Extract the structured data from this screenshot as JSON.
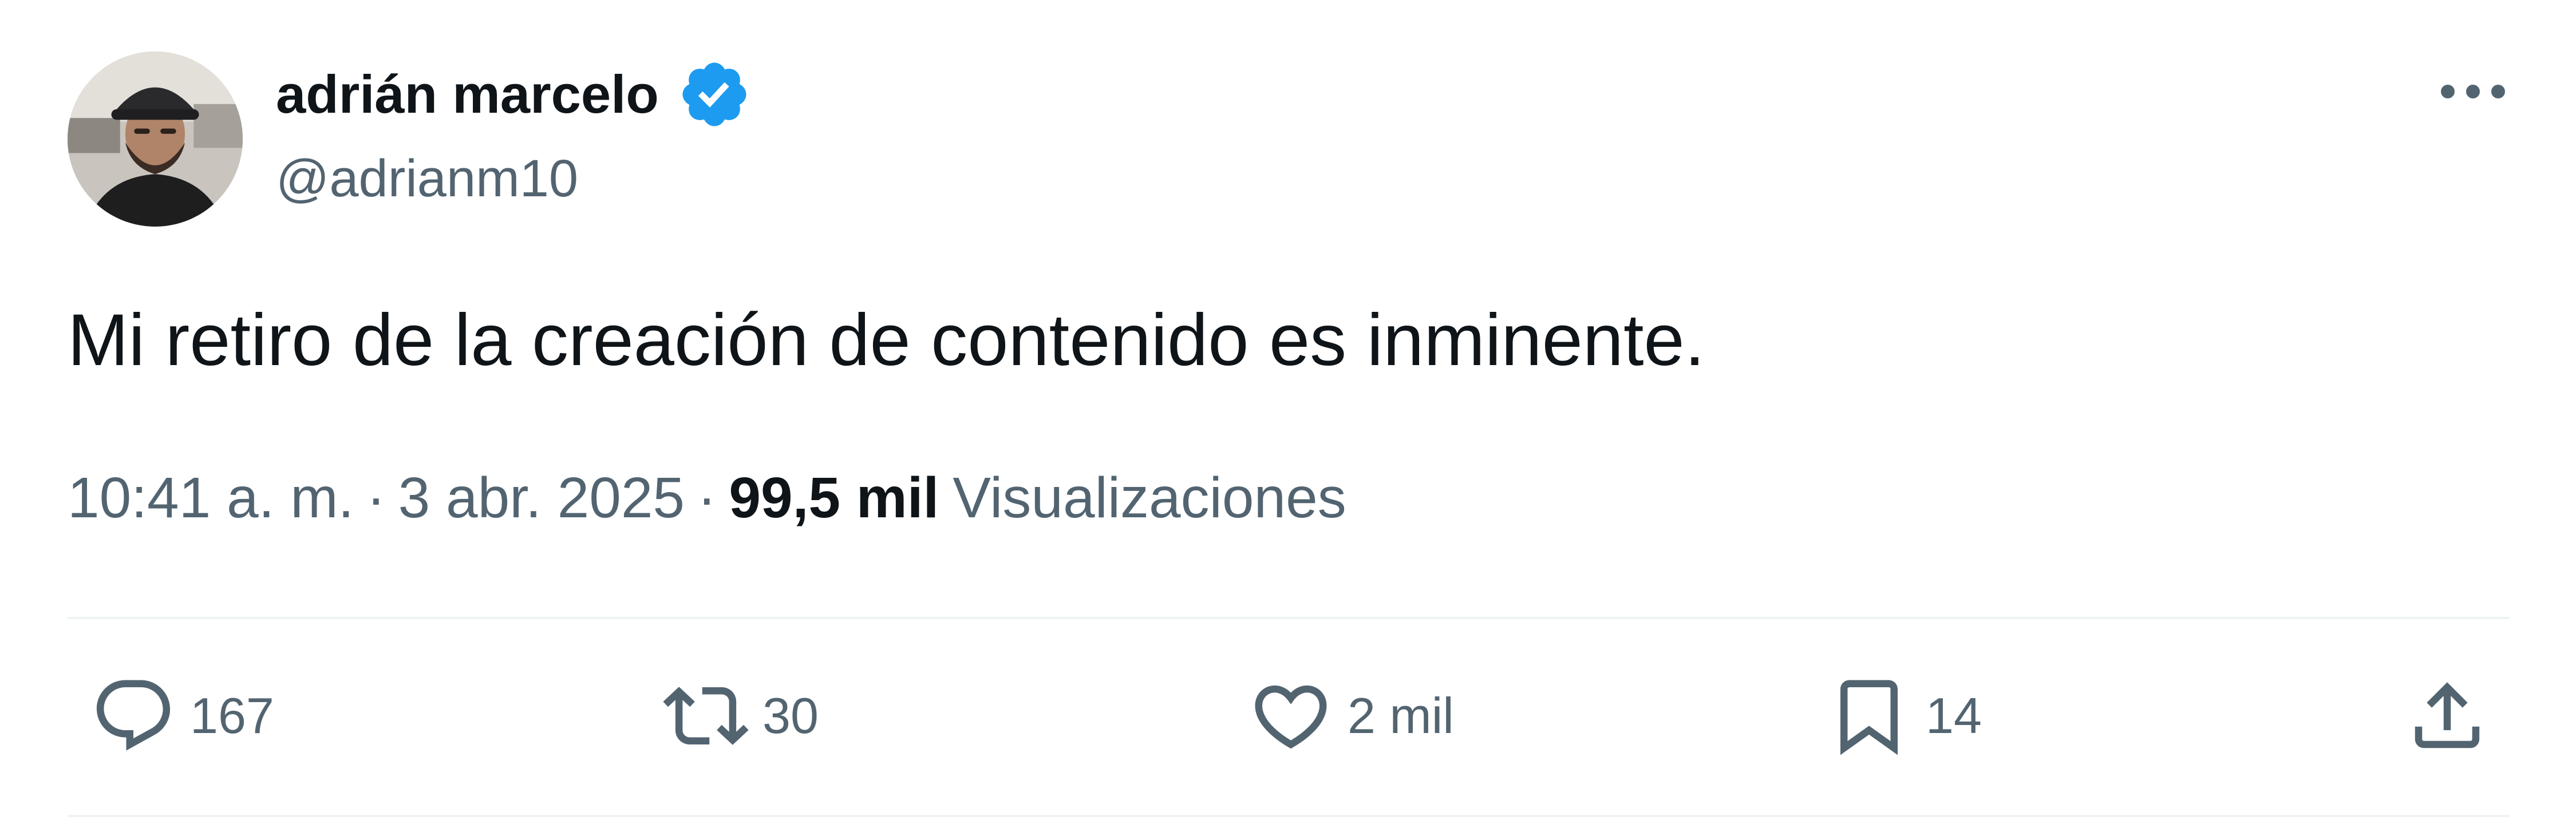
{
  "author": {
    "display_name": "adrián marcelo",
    "handle": "@adrianm10",
    "verified": true
  },
  "tweet": {
    "text": "Mi retiro de la creación de contenido es inminente.",
    "time": "10:41 a. m.",
    "date": "3 abr. 2025",
    "views_count": "99,5 mil",
    "views_label": "Visualizaciones"
  },
  "actions": {
    "replies": "167",
    "retweets": "30",
    "likes": "2 mil",
    "bookmarks": "14"
  },
  "icons": {
    "verified": "verified-badge-icon",
    "more": "more-options-icon",
    "reply": "reply-icon",
    "retweet": "retweet-icon",
    "like": "heart-icon",
    "bookmark": "bookmark-icon",
    "share": "share-icon"
  },
  "colors": {
    "text_primary": "#0f1419",
    "text_secondary": "#536471",
    "verified_blue": "#1d9bf0",
    "divider": "#eff3f4"
  }
}
